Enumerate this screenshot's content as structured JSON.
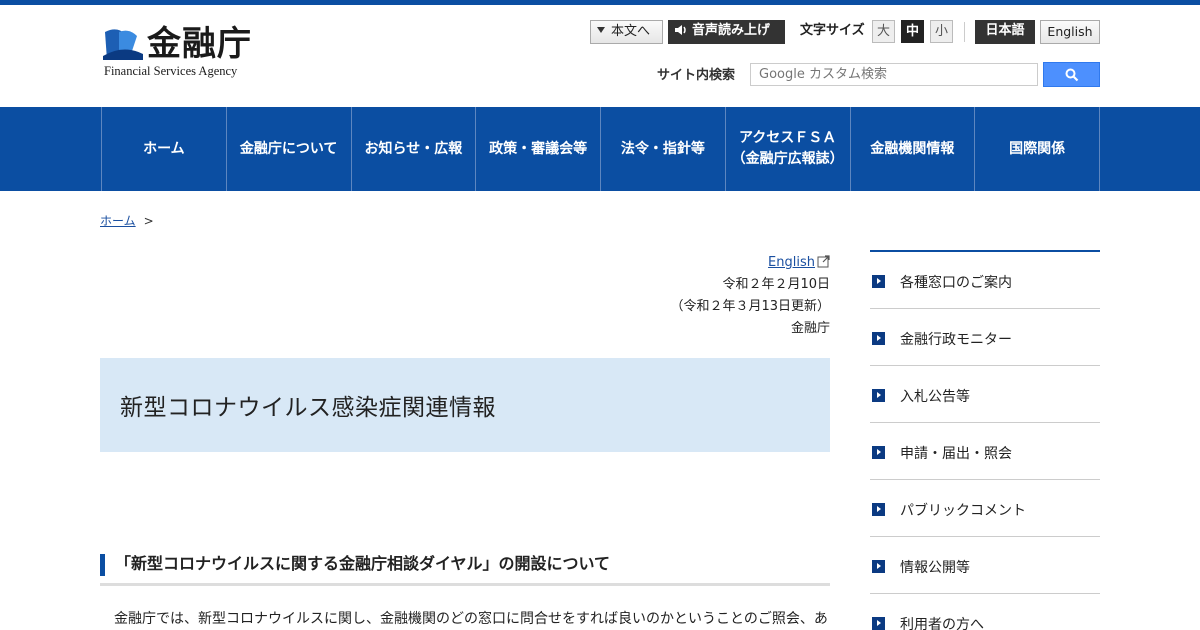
{
  "header": {
    "logo_text": "金融庁",
    "logo_sub": "Financial Services Agency",
    "skip_link": "本文へ",
    "voice_button": "音声読み上げ",
    "font_size_label": "文字サイズ",
    "font_sizes": [
      "大",
      "中",
      "小"
    ],
    "lang_ja": "日本語",
    "lang_en": "English",
    "search_label": "サイト内検索",
    "search_placeholder": "Google カスタム検索",
    "brand_color": "#0b4ea2"
  },
  "nav": {
    "items": [
      {
        "label": "ホーム"
      },
      {
        "label": "金融庁について"
      },
      {
        "label": "お知らせ・広報"
      },
      {
        "label": "政策・審議会等"
      },
      {
        "label": "法令・指針等"
      },
      {
        "label": "アクセスＦＳＡ\n（金融庁広報誌）"
      },
      {
        "label": "金融機関情報"
      },
      {
        "label": "国際関係"
      }
    ]
  },
  "breadcrumb": {
    "home": "ホーム",
    "separator": ">"
  },
  "meta": {
    "english_link": "English",
    "date": "令和２年２月10日",
    "updated": "（令和２年３月13日更新）",
    "agency": "金融庁"
  },
  "main": {
    "title": "新型コロナウイルス感染症関連情報",
    "section_heading": "「新型コロナウイルスに関する金融庁相談ダイヤル」の開設について",
    "paragraph": "金融庁では、新型コロナウイルスに関し、金融機関のどの窓口に問合せをすれば良いのかということのご照会、あ"
  },
  "sidebar": {
    "items": [
      {
        "label": "各種窓口のご案内"
      },
      {
        "label": "金融行政モニター"
      },
      {
        "label": "入札公告等"
      },
      {
        "label": "申請・届出・照会"
      },
      {
        "label": "パブリックコメント"
      },
      {
        "label": "情報公開等"
      },
      {
        "label": "利用者の方へ"
      }
    ]
  }
}
